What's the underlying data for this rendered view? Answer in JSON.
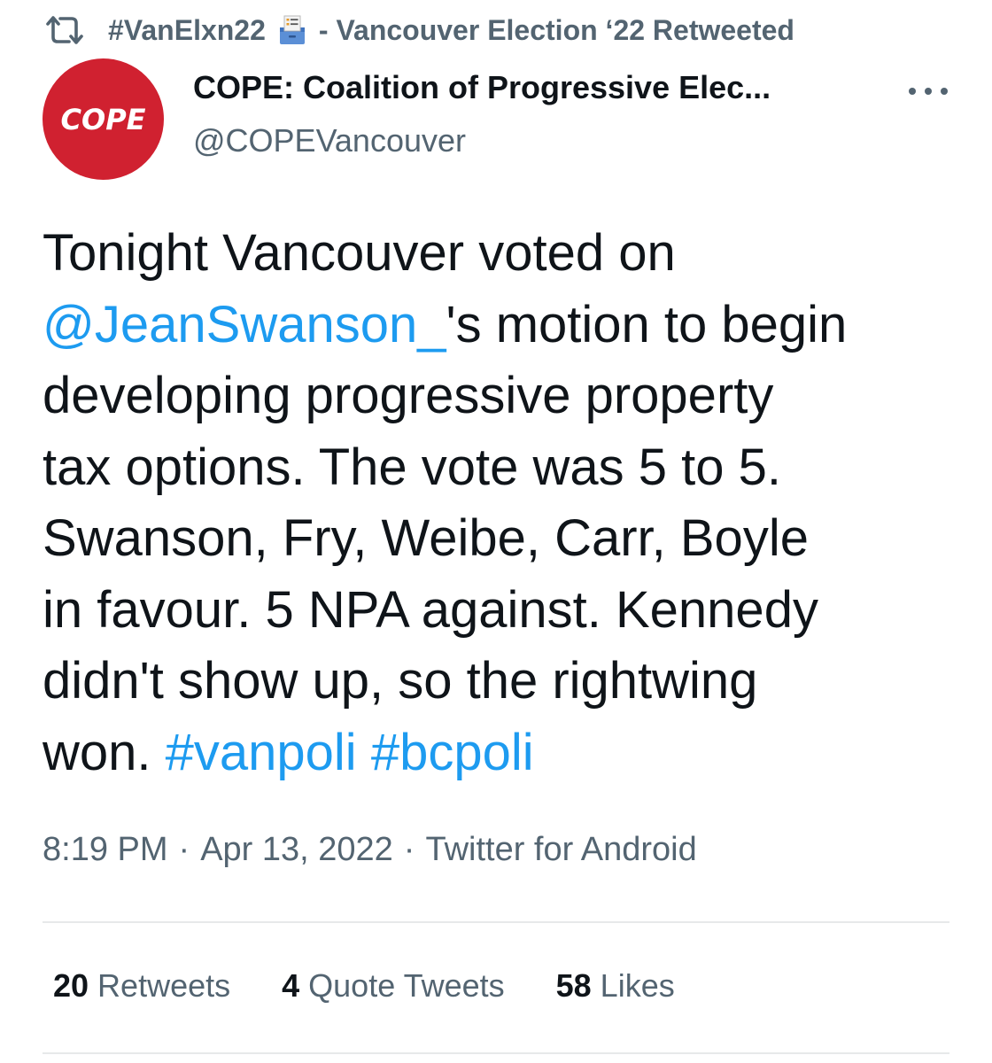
{
  "retweet_header": {
    "hashtag": "#VanElxn22",
    "rest": "- Vancouver Election ‘22 Retweeted"
  },
  "author": {
    "avatar_text": "COPE",
    "avatar_color": "#d02130",
    "display_name": "COPE: Coalition of Progressive Elec...",
    "handle": "@COPEVancouver"
  },
  "tweet": {
    "lines": [
      [
        {
          "t": "Tonight Vancouver voted on"
        }
      ],
      [
        {
          "t": "@JeanSwanson_",
          "link": true
        },
        {
          "t": "'s motion to begin"
        }
      ],
      [
        {
          "t": "developing progressive property"
        }
      ],
      [
        {
          "t": "tax options. The vote was 5 to 5."
        }
      ],
      [
        {
          "t": "Swanson, Fry, Weibe, Carr, Boyle"
        }
      ],
      [
        {
          "t": "in favour. 5 NPA against. Kennedy"
        }
      ],
      [
        {
          "t": "didn't show up, so the rightwing"
        }
      ],
      [
        {
          "t": "won. "
        },
        {
          "t": "#vanpoli",
          "link": true
        },
        {
          "t": " "
        },
        {
          "t": "#bcpoli",
          "link": true
        }
      ]
    ]
  },
  "meta": {
    "time": "8:19 PM",
    "date": "Apr 13, 2022",
    "source": "Twitter for Android",
    "separator": "·"
  },
  "stats": {
    "retweets_count": "20",
    "retweets_label": "Retweets",
    "quotes_count": "4",
    "quotes_label": "Quote Tweets",
    "likes_count": "58",
    "likes_label": "Likes"
  },
  "colors": {
    "link": "#1d9bf0",
    "secondary_text": "#536471",
    "primary_text": "#0f1419"
  },
  "icons": {
    "retweet": "retweet-icon",
    "ballot": "ballot-box-icon",
    "more": "more-horizontal-icon"
  }
}
